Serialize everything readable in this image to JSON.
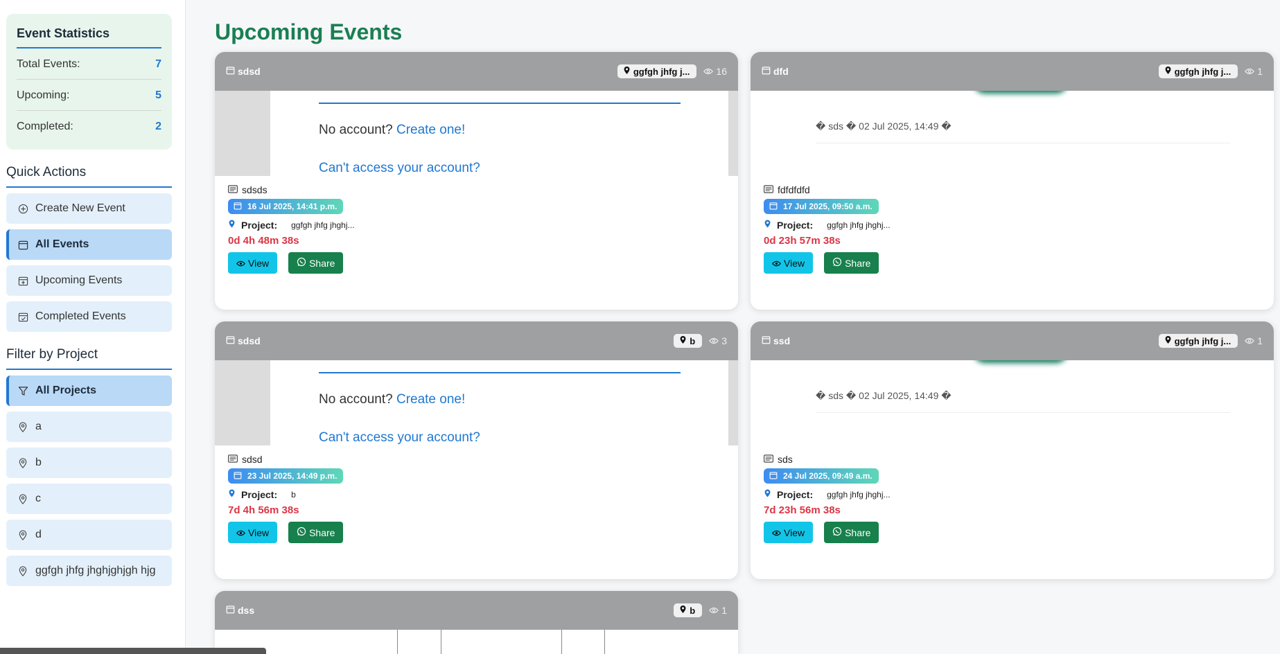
{
  "sidebar": {
    "stats": {
      "title": "Event Statistics",
      "rows": [
        {
          "label": "Total Events:",
          "value": "7"
        },
        {
          "label": "Upcoming:",
          "value": "5"
        },
        {
          "label": "Completed:",
          "value": "2"
        }
      ]
    },
    "quick_actions": {
      "title": "Quick Actions",
      "items": [
        {
          "label": "Create New Event",
          "icon": "plus-circle-icon"
        },
        {
          "label": "All Events",
          "icon": "calendar-icon",
          "active": true
        },
        {
          "label": "Upcoming Events",
          "icon": "calendar-plus-icon"
        },
        {
          "label": "Completed Events",
          "icon": "calendar-check-icon"
        }
      ]
    },
    "filter": {
      "title": "Filter by Project",
      "items": [
        {
          "label": "All Projects",
          "icon": "funnel-icon",
          "active": true
        },
        {
          "label": "a",
          "icon": "location-pin-icon"
        },
        {
          "label": "b",
          "icon": "location-pin-icon"
        },
        {
          "label": "c",
          "icon": "location-pin-icon"
        },
        {
          "label": "d",
          "icon": "location-pin-icon"
        },
        {
          "label": "ggfgh jhfg jhghjghjgh hjg",
          "icon": "location-pin-icon"
        }
      ]
    }
  },
  "main": {
    "title": "Upcoming Events",
    "cards": [
      {
        "title": "sdsd",
        "location": "ggfgh jhfg j...",
        "views": "16",
        "preview_type": "login",
        "preview": {
          "no_account": "No account?",
          "create": "Create one!",
          "cant_access": "Can't access your account?"
        },
        "description": "sdsds",
        "date": "16 Jul 2025, 14:41 p.m.",
        "project_label": "Project:",
        "project": "ggfgh jhfg jhghj...",
        "countdown": "0d 4h 48m 38s"
      },
      {
        "title": "dfd",
        "location": "ggfgh jhfg j...",
        "views": "1",
        "preview_type": "note",
        "preview": {
          "text": "� sds � 02 Jul 2025, 14:49 �"
        },
        "description": "fdfdfdfd",
        "date": "17 Jul 2025, 09:50 a.m.",
        "project_label": "Project:",
        "project": "ggfgh jhfg jhghj...",
        "countdown": "0d 23h 57m 38s"
      },
      {
        "title": "sdsd",
        "location": "b",
        "views": "3",
        "preview_type": "login",
        "preview": {
          "no_account": "No account?",
          "create": "Create one!",
          "cant_access": "Can't access your account?"
        },
        "description": "sdsd",
        "date": "23 Jul 2025, 14:49 p.m.",
        "project_label": "Project:",
        "project": "b",
        "countdown": "7d 4h 56m 38s"
      },
      {
        "title": "ssd",
        "location": "ggfgh jhfg j...",
        "views": "1",
        "preview_type": "note",
        "preview": {
          "text": "� sds � 02 Jul 2025, 14:49 �"
        },
        "description": "sds",
        "date": "24 Jul 2025, 09:49 a.m.",
        "project_label": "Project:",
        "project": "ggfgh jhfg jhghj...",
        "countdown": "7d 23h 56m 38s"
      },
      {
        "title": "dss",
        "location": "b",
        "views": "1"
      }
    ],
    "buttons": {
      "view": "View",
      "share": "Share"
    }
  },
  "colors": {
    "accent_blue": "#1f78d1",
    "title_green": "#1a7f52",
    "countdown_red": "#dc3545",
    "view_button": "#12c5e8",
    "share_button": "#17804c"
  }
}
